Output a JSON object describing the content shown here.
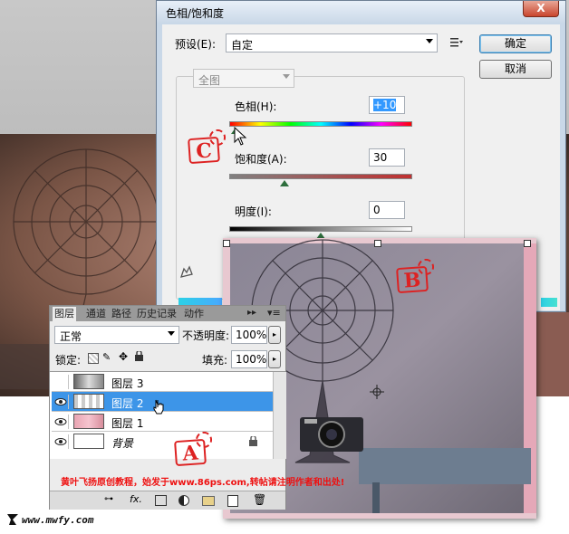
{
  "hue_sat_dialog": {
    "title": "色相/饱和度",
    "close_label": "X",
    "preset_label": "预设(E):",
    "preset_value": "自定",
    "ok_label": "确定",
    "cancel_label": "取消",
    "channel_value": "全图",
    "hue": {
      "label": "色相(H):",
      "value": "+10",
      "level": 0.53
    },
    "saturation": {
      "label": "饱和度(A):",
      "value": "30",
      "level": 0.3
    },
    "lightness": {
      "label": "明度(I):",
      "value": "0",
      "level": 0.5
    }
  },
  "layers_panel": {
    "tabs": [
      "图层",
      "通道",
      "路径",
      "历史记录",
      "动作"
    ],
    "blend_mode": "正常",
    "opacity_label": "不透明度:",
    "opacity_value": "100%",
    "lock_label": "锁定:",
    "fill_label": "填充:",
    "fill_value": "100%",
    "layers": [
      {
        "name": "图层 3",
        "visible": false,
        "selected": false
      },
      {
        "name": "图层 2",
        "visible": true,
        "selected": true
      },
      {
        "name": "图层 1",
        "visible": true,
        "selected": false
      },
      {
        "name": "背景",
        "visible": true,
        "selected": false,
        "locked": true
      }
    ],
    "footer_icons": [
      "link-icon",
      "fx-icon",
      "mask-icon",
      "adjustment-icon",
      "folder-icon",
      "new-layer-icon",
      "trash-icon"
    ]
  },
  "annotations": {
    "stamp_a": "A",
    "stamp_b": "B",
    "stamp_c": "C",
    "credit": "黄叶飞扬原创教程，始发于www.86ps.com,转帖请注明作者和出处!",
    "watermark": "www.mwfy.com"
  },
  "colors": {
    "dialog_bg": "#f0f0f0",
    "title_bar": "#cbd9e8",
    "close_red": "#c9452d",
    "selected_layer": "#3d95e8",
    "stamp_red": "#dd2222"
  }
}
